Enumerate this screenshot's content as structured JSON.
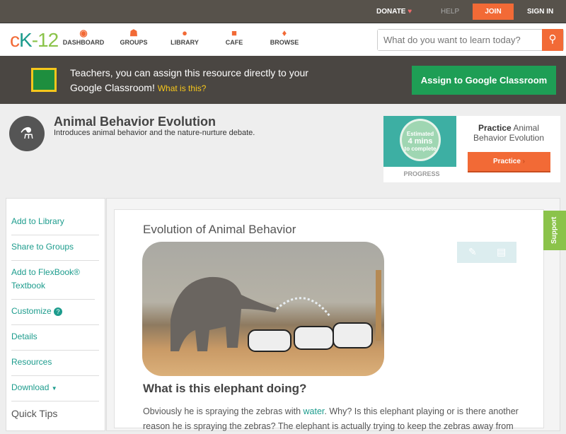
{
  "topbar": {
    "donate": "DONATE",
    "help": "HELP",
    "join": "JOIN",
    "signin": "SIGN IN"
  },
  "nav": {
    "logo": "CK-12",
    "items": [
      {
        "label": "DASHBOARD"
      },
      {
        "label": "GROUPS"
      },
      {
        "label": "LIBRARY"
      },
      {
        "label": "CAFE"
      },
      {
        "label": "BROWSE"
      }
    ],
    "search_placeholder": "What do you want to learn today?"
  },
  "banner": {
    "text": "Teachers, you can assign this resource directly to your Google Classroom!",
    "link": "What is this?",
    "button": "Assign to Google Classroom"
  },
  "header": {
    "title": "Animal Behavior Evolution",
    "subtitle": "Introduces animal behavior and the nature-nurture debate."
  },
  "practice": {
    "estimated": "Estimated",
    "mins": "4 mins",
    "complete": "to complete",
    "progress": "PROGRESS",
    "title_bold": "Practice",
    "title_rest": "Animal Behavior Evolution",
    "button": "Practice"
  },
  "sidebar": {
    "items": [
      {
        "label": "Add to Library"
      },
      {
        "label": "Share to Groups"
      },
      {
        "label": "Add to FlexBook® Textbook"
      },
      {
        "label": "Customize"
      },
      {
        "label": "Details"
      },
      {
        "label": "Resources"
      },
      {
        "label": "Download"
      }
    ],
    "quick_tips": "Quick Tips"
  },
  "content": {
    "heading": "Evolution of Animal Behavior",
    "question": "What is this elephant doing?",
    "para_before": "Obviously he is spraying the zebras with ",
    "para_link": "water",
    "para_after": ". Why? Is this elephant playing or is there another reason he is spraying the zebras? The elephant is actually trying to keep the zebras away from"
  },
  "support": "Support"
}
